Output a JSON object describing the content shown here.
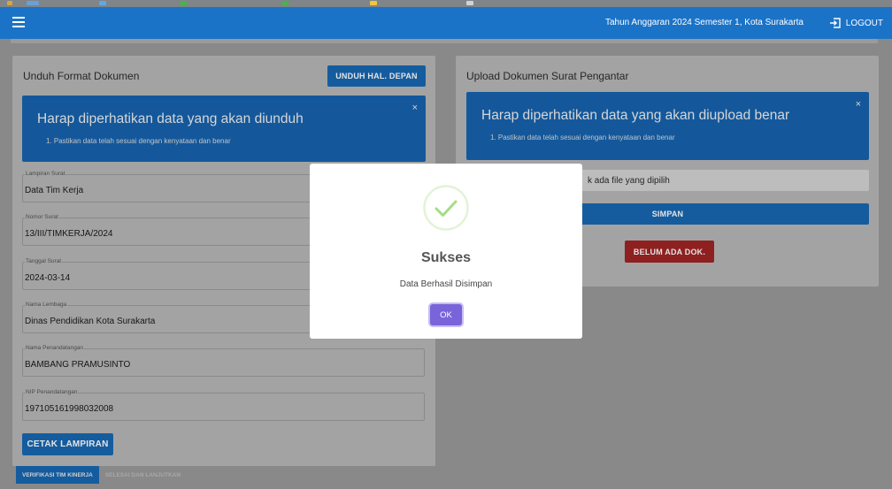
{
  "header": {
    "info": "Tahun Anggaran 2024 Semester 1, Kota Surakarta",
    "logout_label": "LOGOUT"
  },
  "left_card": {
    "title": "Unduh Format Dokumen",
    "download_front_button": "UNDUH HAL. DEPAN",
    "alert": {
      "title": "Harap diperhatikan data yang akan diunduh",
      "item": "1. Pastikan data telah sesuai dengan kenyataan dan benar",
      "close": "×"
    },
    "fields": [
      {
        "label": "Lampiran Surat",
        "value": "Data Tim Kerja"
      },
      {
        "label": "Nomor Surat",
        "value": "13/III/TIMKERJA/2024"
      },
      {
        "label": "Tanggal Surat",
        "value": "2024-03-14"
      },
      {
        "label": "Nama Lembaga",
        "value": "Dinas Pendidikan Kota Surakarta"
      },
      {
        "label": "Nama Penandatangan",
        "value": "BAMBANG PRAMUSINTO"
      },
      {
        "label": "NIP Penandatangan",
        "value": "197105161998032008"
      }
    ],
    "print_button": "CETAK LAMPIRAN"
  },
  "right_card": {
    "title": "Upload Dokumen Surat Pengantar",
    "alert": {
      "title": "Harap diperhatikan data yang akan diupload benar",
      "item": "1. Pastikan data telah sesuai dengan kenyataan dan benar",
      "close": "×"
    },
    "file_text": "k ada file yang dipilih",
    "save_button": "SIMPAN",
    "no_doc_button": "BELUM ADA DOK."
  },
  "tabs": [
    {
      "label": "VERIFIKASI TIM KINERJA",
      "active": true
    },
    {
      "label": "SELESAI DAN LANJUTKAN",
      "active": false
    }
  ],
  "modal": {
    "title": "Sukses",
    "message": "Data Berhasil Disimpan",
    "ok_label": "OK"
  },
  "colors": {
    "appbar": "#1b73c7",
    "primary_button": "#155c9e",
    "danger_button": "#8e2020",
    "success": "#a5dc86",
    "confirm": "#7a64d9"
  }
}
